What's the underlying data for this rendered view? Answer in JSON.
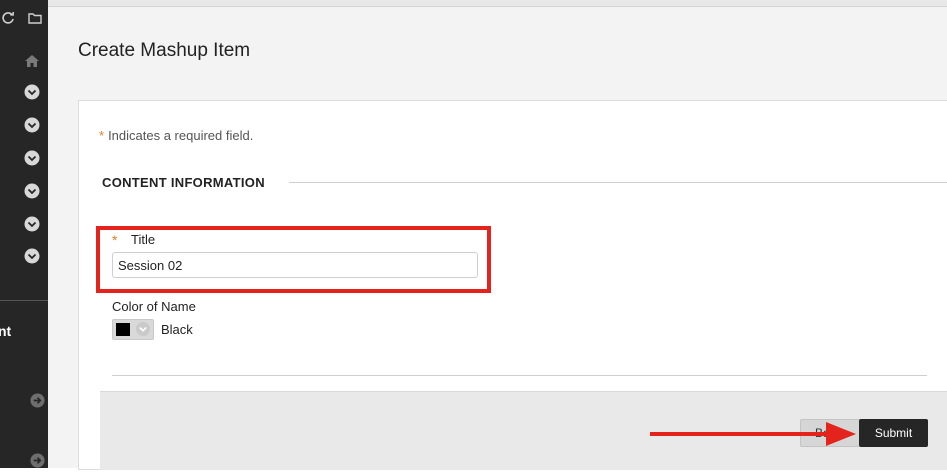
{
  "page": {
    "title": "Create Mashup Item",
    "required_note": "Indicates a required field.",
    "required_star": "*"
  },
  "section": {
    "heading": "CONTENT INFORMATION"
  },
  "form": {
    "title_label": "Title",
    "title_value": "Session 02",
    "color_label": "Color of Name",
    "color_value": "Black",
    "color_hex": "#000000"
  },
  "sidebar": {
    "partial_label": "nt",
    "icons": [
      "refresh-icon",
      "folder-icon",
      "home-icon",
      "chevron-down-icon",
      "chevron-down-icon",
      "chevron-down-icon",
      "chevron-down-icon",
      "chevron-down-icon",
      "chevron-down-icon",
      "arrow-right-icon",
      "arrow-right-icon"
    ]
  },
  "buttons": {
    "cancel_label": "Ba",
    "submit_label": "Submit"
  },
  "colors": {
    "accent_required": "#e67e22",
    "highlight": "#e4241c",
    "submit_bg": "#262626",
    "sidebar_bg": "#262626"
  }
}
